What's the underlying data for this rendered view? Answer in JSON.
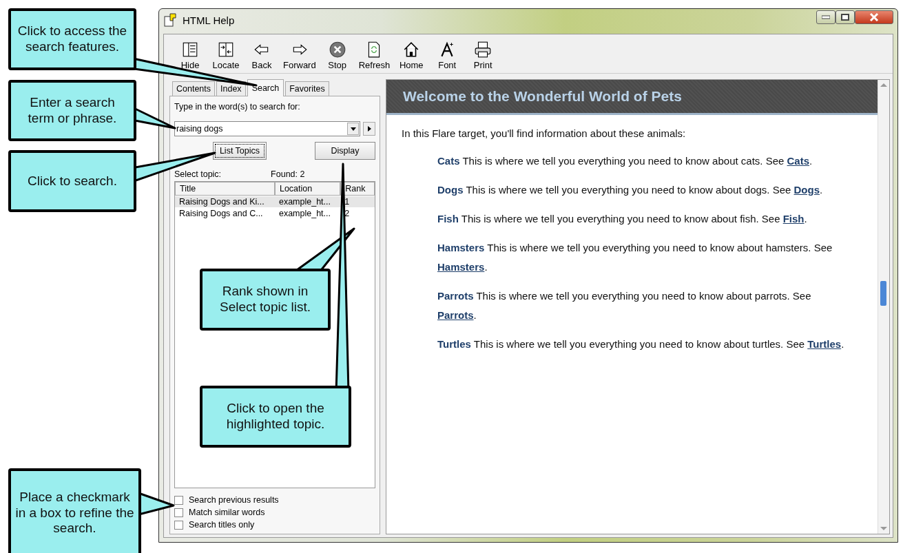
{
  "window": {
    "title": "HTML Help"
  },
  "toolbar": [
    {
      "label": "Hide"
    },
    {
      "label": "Locate"
    },
    {
      "label": "Back"
    },
    {
      "label": "Forward"
    },
    {
      "label": "Stop"
    },
    {
      "label": "Refresh"
    },
    {
      "label": "Home"
    },
    {
      "label": "Font"
    },
    {
      "label": "Print"
    }
  ],
  "tabs": [
    {
      "label": "Contents",
      "selected": false
    },
    {
      "label": "Index",
      "selected": false
    },
    {
      "label": "Search",
      "selected": true
    },
    {
      "label": "Favorites",
      "selected": false
    }
  ],
  "search": {
    "prompt": "Type in the word(s) to search for:",
    "value": "raising dogs",
    "list_button": "List Topics",
    "display_button": "Display",
    "select_label": "Select topic:",
    "found": "Found: 2"
  },
  "results": {
    "columns": [
      "Title",
      "Location",
      "Rank"
    ],
    "rows": [
      {
        "cells": [
          "Raising Dogs and Ki...",
          "example_ht...",
          "1"
        ],
        "selected": true
      },
      {
        "cells": [
          "Raising Dogs and C...",
          "example_ht...",
          "2"
        ],
        "selected": false
      }
    ]
  },
  "options": [
    {
      "label": "Search previous results",
      "checked": false
    },
    {
      "label": "Match similar words",
      "checked": false
    },
    {
      "label": "Search titles only",
      "checked": false
    }
  ],
  "content": {
    "heading": "Welcome to the Wonderful World of Pets",
    "intro": "In this Flare target, you'll find information about these animals:",
    "entries": [
      {
        "name": "Cats",
        "text": "This is where we tell you everything you need to know about cats. See",
        "link": "Cats",
        "end": "."
      },
      {
        "name": "Dogs",
        "text": "This is where we tell you everything you need to know about dogs. See",
        "link": "Dogs",
        "end": "."
      },
      {
        "name": "Fish",
        "text": "This is where we tell you everything you need to know about fish. See",
        "link": "Fish",
        "end": "."
      },
      {
        "name": "Hamsters",
        "text": "This is where we tell you everything you need to know about hamsters. See",
        "link": "Hamsters",
        "end": "."
      },
      {
        "name": "Parrots",
        "text": "This is where we tell you everything you need to know about parrots. See",
        "link": "Parrots",
        "end": "."
      },
      {
        "name": "Turtles",
        "text": "This is where we tell you everything you need to know about turtles. See",
        "link": "Turtles",
        "end": "."
      }
    ]
  },
  "callouts": [
    {
      "text": "Click to access the search features."
    },
    {
      "text": "Enter a search term or phrase."
    },
    {
      "text": "Click to search."
    },
    {
      "text": "Place a checkmark in a box to refine the search."
    },
    {
      "text": "Rank shown in Select topic list."
    },
    {
      "text": "Click to open the highlighted topic."
    }
  ]
}
